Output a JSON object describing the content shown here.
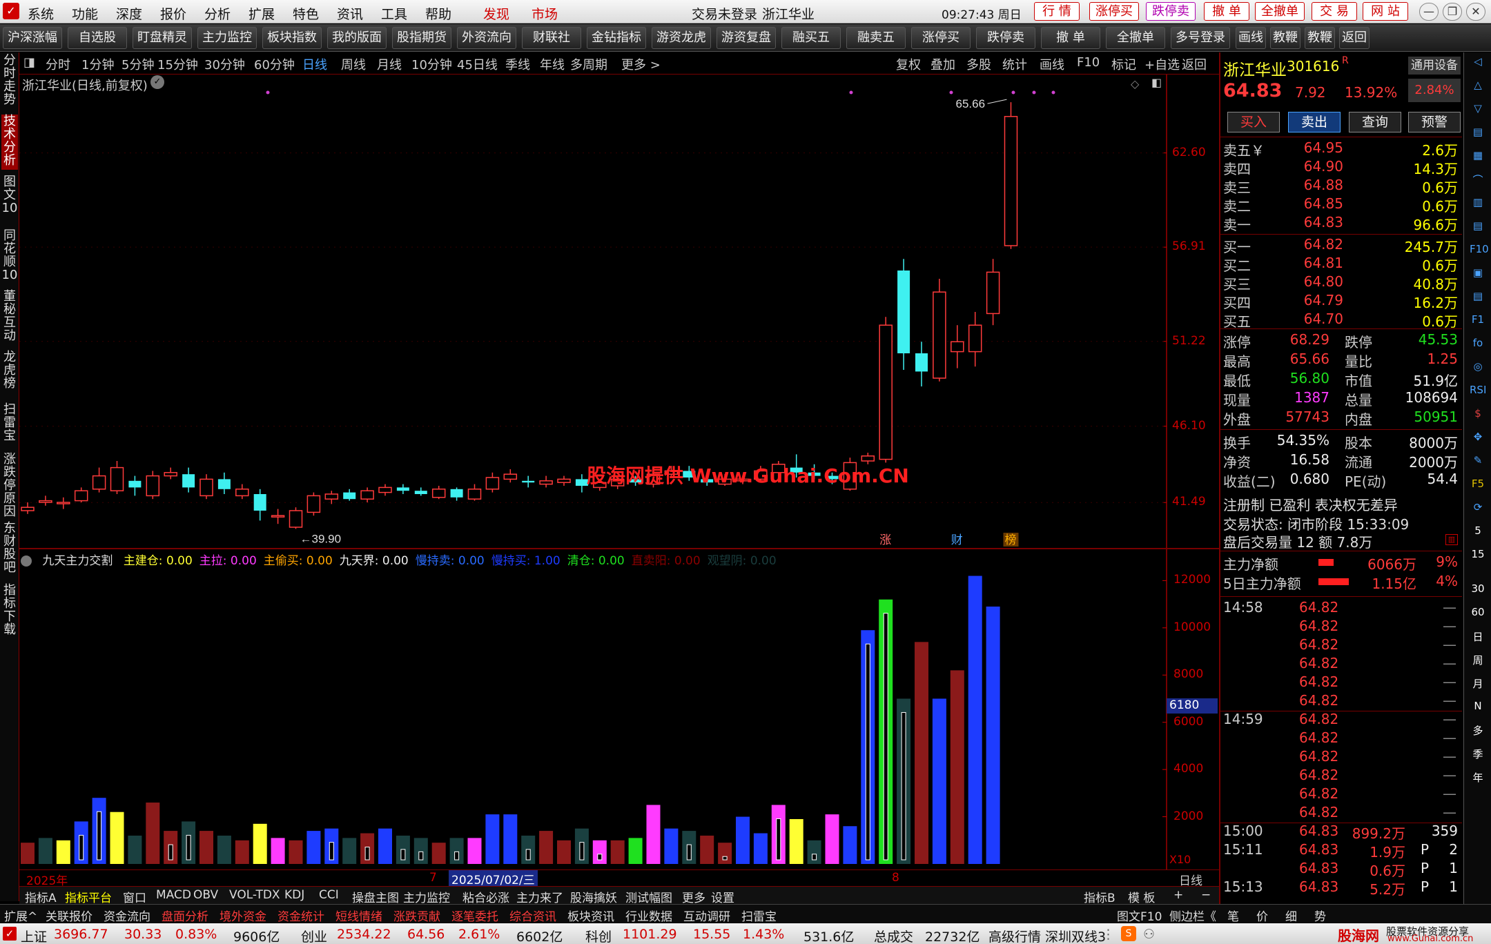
{
  "menubar": {
    "items": [
      "系统",
      "功能",
      "深度",
      "报价",
      "分析",
      "扩展",
      "特色",
      "资讯",
      "工具",
      "帮助"
    ],
    "discover": "发现",
    "market": "市场",
    "login_status": "交易未登录",
    "stock_title": "浙江华业",
    "clock": "09:27:43 周日",
    "top_buttons": [
      "行 情",
      "涨停买",
      "跌停卖",
      "撤 单",
      "全撤单",
      "交 易",
      "网 站"
    ]
  },
  "toolbar": {
    "buttons": [
      "沪深涨幅",
      "自选股",
      "盯盘精灵",
      "主力监控",
      "板块指数",
      "我的版面",
      "股指期货",
      "外资流向",
      "财联社",
      "金钻指标",
      "游资龙虎",
      "游资复盘",
      "融买五",
      "融卖五",
      "涨停买",
      "跌停卖",
      "撤 单",
      "全撤单",
      "多号登录",
      "画线",
      "教鞭A",
      "教鞭B",
      "返回"
    ]
  },
  "left_tabs": [
    "分时走势",
    "技术分析",
    "图文10",
    "同花顺10",
    "董秘互动",
    "龙虎榜",
    "扫雷宝",
    "涨跌停原因",
    "东财股吧",
    "指标下载"
  ],
  "periods": {
    "items": [
      "分时",
      "1分钟",
      "5分钟",
      "15分钟",
      "30分钟",
      "60分钟",
      "日线",
      "周线",
      "月线",
      "10分钟",
      "45日线",
      "季线",
      "年线",
      "多周期",
      "更多 >"
    ],
    "active": "日线",
    "right_items": [
      "复权",
      "叠加",
      "多股",
      "统计",
      "画线",
      "F10",
      "标记",
      "+自选",
      "返回"
    ]
  },
  "chart": {
    "title": "浙江华业(日线,前复权)",
    "high_label": "65.66",
    "low_label": "39.90",
    "y_ticks": [
      "62.60",
      "56.91",
      "51.22",
      "46.10",
      "41.49"
    ],
    "event_markers": [
      "涨",
      "财",
      "榜"
    ],
    "watermark": "股海网提供 Www.Guhai.Com.CN"
  },
  "chart_data": {
    "type": "candlestick",
    "title": "浙江华业(日线,前复权)",
    "ylim": [
      39.5,
      66.5
    ],
    "candles": [
      {
        "o": 41.0,
        "c": 41.2,
        "h": 41.5,
        "l": 40.8
      },
      {
        "o": 41.5,
        "c": 41.6,
        "h": 41.9,
        "l": 41.3
      },
      {
        "o": 41.5,
        "c": 41.5,
        "h": 41.8,
        "l": 41.1
      },
      {
        "o": 41.6,
        "c": 42.2,
        "h": 42.4,
        "l": 41.5
      },
      {
        "o": 42.3,
        "c": 43.1,
        "h": 43.6,
        "l": 42.1
      },
      {
        "o": 42.2,
        "c": 43.6,
        "h": 44.0,
        "l": 42.0
      },
      {
        "o": 42.8,
        "c": 42.4,
        "h": 43.1,
        "l": 41.9
      },
      {
        "o": 41.9,
        "c": 43.1,
        "h": 43.4,
        "l": 41.7
      },
      {
        "o": 43.1,
        "c": 43.3,
        "h": 43.6,
        "l": 42.9
      },
      {
        "o": 43.2,
        "c": 42.4,
        "h": 43.6,
        "l": 42.1
      },
      {
        "o": 41.9,
        "c": 42.9,
        "h": 43.2,
        "l": 41.7
      },
      {
        "o": 42.9,
        "c": 42.3,
        "h": 43.3,
        "l": 42.0
      },
      {
        "o": 41.9,
        "c": 42.3,
        "h": 42.6,
        "l": 41.7
      },
      {
        "o": 42.0,
        "c": 41.0,
        "h": 42.3,
        "l": 40.4
      },
      {
        "o": 40.7,
        "c": 40.7,
        "h": 41.1,
        "l": 40.2
      },
      {
        "o": 40.0,
        "c": 41.0,
        "h": 41.2,
        "l": 39.9
      },
      {
        "o": 40.9,
        "c": 41.9,
        "h": 42.1,
        "l": 40.7
      },
      {
        "o": 41.7,
        "c": 42.0,
        "h": 42.2,
        "l": 41.4
      },
      {
        "o": 42.1,
        "c": 41.7,
        "h": 42.3,
        "l": 41.6
      },
      {
        "o": 41.7,
        "c": 42.2,
        "h": 42.4,
        "l": 41.5
      },
      {
        "o": 42.1,
        "c": 42.4,
        "h": 42.6,
        "l": 41.9
      },
      {
        "o": 42.4,
        "c": 42.2,
        "h": 42.6,
        "l": 42.0
      },
      {
        "o": 42.2,
        "c": 42.0,
        "h": 42.4,
        "l": 41.9
      },
      {
        "o": 41.8,
        "c": 42.3,
        "h": 42.5,
        "l": 41.7
      },
      {
        "o": 42.3,
        "c": 41.8,
        "h": 42.4,
        "l": 41.6
      },
      {
        "o": 41.7,
        "c": 42.3,
        "h": 42.6,
        "l": 41.6
      },
      {
        "o": 42.3,
        "c": 43.0,
        "h": 43.3,
        "l": 42.1
      },
      {
        "o": 42.9,
        "c": 43.2,
        "h": 43.5,
        "l": 42.7
      },
      {
        "o": 42.8,
        "c": 42.7,
        "h": 43.1,
        "l": 42.4
      },
      {
        "o": 42.6,
        "c": 42.8,
        "h": 43.1,
        "l": 42.4
      },
      {
        "o": 42.7,
        "c": 42.9,
        "h": 43.1,
        "l": 42.5
      },
      {
        "o": 42.9,
        "c": 42.5,
        "h": 43.2,
        "l": 42.1
      },
      {
        "o": 42.4,
        "c": 42.7,
        "h": 42.9,
        "l": 42.2
      },
      {
        "o": 42.5,
        "c": 42.9,
        "h": 43.1,
        "l": 42.3
      },
      {
        "o": 42.9,
        "c": 42.7,
        "h": 43.1,
        "l": 42.5
      },
      {
        "o": 42.6,
        "c": 43.2,
        "h": 43.5,
        "l": 42.4
      },
      {
        "o": 43.2,
        "c": 43.4,
        "h": 43.7,
        "l": 43.0
      },
      {
        "o": 43.4,
        "c": 43.0,
        "h": 43.7,
        "l": 42.8
      },
      {
        "o": 42.9,
        "c": 42.7,
        "h": 43.1,
        "l": 42.5
      },
      {
        "o": 42.6,
        "c": 42.9,
        "h": 43.2,
        "l": 42.5
      },
      {
        "o": 42.8,
        "c": 42.9,
        "h": 43.1,
        "l": 42.6
      },
      {
        "o": 42.9,
        "c": 43.4,
        "h": 43.7,
        "l": 42.8
      },
      {
        "o": 43.3,
        "c": 43.8,
        "h": 44.0,
        "l": 43.1
      },
      {
        "o": 43.6,
        "c": 43.3,
        "h": 44.4,
        "l": 43.0
      },
      {
        "o": 43.3,
        "c": 43.1,
        "h": 43.8,
        "l": 42.9
      },
      {
        "o": 43.1,
        "c": 42.9,
        "h": 43.3,
        "l": 42.6
      },
      {
        "o": 42.3,
        "c": 43.9,
        "h": 44.2,
        "l": 42.2
      },
      {
        "o": 44.0,
        "c": 44.3,
        "h": 44.5,
        "l": 43.8
      },
      {
        "o": 44.1,
        "c": 52.2,
        "h": 52.7,
        "l": 43.9
      },
      {
        "o": 55.5,
        "c": 50.5,
        "h": 56.2,
        "l": 49.5
      },
      {
        "o": 50.5,
        "c": 49.4,
        "h": 51.2,
        "l": 48.5
      },
      {
        "o": 49.0,
        "c": 54.2,
        "h": 55.0,
        "l": 48.8
      },
      {
        "o": 50.6,
        "c": 51.2,
        "h": 52.2,
        "l": 49.6
      },
      {
        "o": 50.6,
        "c": 52.2,
        "h": 53.0,
        "l": 49.7
      },
      {
        "o": 52.9,
        "c": 55.4,
        "h": 56.2,
        "l": 52.2
      },
      {
        "o": 57.0,
        "c": 64.8,
        "h": 65.66,
        "l": 56.8
      }
    ]
  },
  "indicator": {
    "name": "九天主力交割",
    "items": [
      {
        "label": "主建仓:",
        "value": "0.00",
        "color": "#ffff33"
      },
      {
        "label": "主拉:",
        "value": "0.00",
        "color": "#ff3bff"
      },
      {
        "label": "主偷买:",
        "value": "0.00",
        "color": "#ffa500"
      },
      {
        "label": "九天界:",
        "value": "0.00",
        "color": "#eeeeee"
      },
      {
        "label": "慢持卖:",
        "value": "0.00",
        "color": "#2a6bff"
      },
      {
        "label": "慢持买:",
        "value": "1.00",
        "color": "#1e3cff"
      },
      {
        "label": "清仓:",
        "value": "0.00",
        "color": "#1fe01f"
      },
      {
        "label": "直卖阳:",
        "value": "0.00",
        "color": "#8b0000"
      },
      {
        "label": "观望阴:",
        "value": "0.00",
        "color": "#1a3d3d"
      }
    ],
    "y_ticks": [
      "12000",
      "10000",
      "8000",
      "6000",
      "4000",
      "2000"
    ],
    "current_marker": "6180",
    "multiplier": "X10",
    "bars": [
      {
        "v": 900,
        "c": "#8b1a1a"
      },
      {
        "v": 1100,
        "c": "#1a4040"
      },
      {
        "v": 1000,
        "c": "#ffff33"
      },
      {
        "v": 1800,
        "c": "#1e3cff",
        "hollow": true
      },
      {
        "v": 2800,
        "c": "#1e3cff",
        "hollow": true
      },
      {
        "v": 2200,
        "c": "#ffff33"
      },
      {
        "v": 1200,
        "c": "#1a4040"
      },
      {
        "v": 2600,
        "c": "#8b1a1a"
      },
      {
        "v": 1400,
        "c": "#8b1a1a",
        "hollow": true
      },
      {
        "v": 1800,
        "c": "#1a4040",
        "hollow": true
      },
      {
        "v": 1400,
        "c": "#8b1a1a"
      },
      {
        "v": 1200,
        "c": "#1a4040"
      },
      {
        "v": 1000,
        "c": "#8b1a1a"
      },
      {
        "v": 1700,
        "c": "#ffff33"
      },
      {
        "v": 1100,
        "c": "#ff3bff"
      },
      {
        "v": 1000,
        "c": "#8b1a1a"
      },
      {
        "v": 1400,
        "c": "#1e3cff"
      },
      {
        "v": 1500,
        "c": "#1e3cff",
        "hollow": true
      },
      {
        "v": 1100,
        "c": "#1a4040"
      },
      {
        "v": 1300,
        "c": "#8b1a1a",
        "hollow": true
      },
      {
        "v": 1500,
        "c": "#1e3cff"
      },
      {
        "v": 1200,
        "c": "#1a4040",
        "hollow": true
      },
      {
        "v": 1100,
        "c": "#1a4040",
        "hollow": true
      },
      {
        "v": 900,
        "c": "#8b1a1a"
      },
      {
        "v": 1100,
        "c": "#1a4040",
        "hollow": true
      },
      {
        "v": 1100,
        "c": "#ff3bff"
      },
      {
        "v": 2100,
        "c": "#1e3cff"
      },
      {
        "v": 2100,
        "c": "#1e3cff"
      },
      {
        "v": 1200,
        "c": "#1a4040",
        "hollow": true
      },
      {
        "v": 1400,
        "c": "#8b1a1a"
      },
      {
        "v": 1000,
        "c": "#8b1a1a"
      },
      {
        "v": 1500,
        "c": "#1a4040",
        "hollow": true
      },
      {
        "v": 1000,
        "c": "#ff3bff",
        "hollow": true
      },
      {
        "v": 1000,
        "c": "#8b1a1a"
      },
      {
        "v": 1100,
        "c": "#1fe01f"
      },
      {
        "v": 2500,
        "c": "#ff3bff"
      },
      {
        "v": 1500,
        "c": "#1e3cff"
      },
      {
        "v": 1400,
        "c": "#1a4040",
        "hollow": true
      },
      {
        "v": 1200,
        "c": "#8b1a1a"
      },
      {
        "v": 900,
        "c": "#8b1a1a",
        "hollow": true
      },
      {
        "v": 2000,
        "c": "#1e3cff"
      },
      {
        "v": 1300,
        "c": "#1e3cff"
      },
      {
        "v": 2500,
        "c": "#ff3bff",
        "hollow": true
      },
      {
        "v": 1900,
        "c": "#ffff33"
      },
      {
        "v": 1000,
        "c": "#1a4040",
        "hollow": true
      },
      {
        "v": 2100,
        "c": "#ff3bff"
      },
      {
        "v": 1600,
        "c": "#1e3cff"
      },
      {
        "v": 9900,
        "c": "#1e3cff",
        "hollow": true
      },
      {
        "v": 11200,
        "c": "#1fe01f",
        "hollow": true
      },
      {
        "v": 7000,
        "c": "#1a4040",
        "hollow": true
      },
      {
        "v": 9400,
        "c": "#8b1a1a"
      },
      {
        "v": 7000,
        "c": "#1e3cff"
      },
      {
        "v": 8200,
        "c": "#8b1a1a"
      },
      {
        "v": 12200,
        "c": "#1e3cff"
      },
      {
        "v": 10900,
        "c": "#1e3cff"
      }
    ]
  },
  "date_axis": {
    "year_label": "2025年",
    "month_7": "7",
    "cursor_date": "2025/07/02/三",
    "month_8": "8",
    "period": "日线"
  },
  "bottom_tabs": {
    "items": [
      "指标A",
      "指标平台",
      "窗口",
      "MACD",
      "OBV",
      "VOL-TDX",
      "KDJ",
      "CCI",
      "操盘主图",
      "主力监控",
      "粘合必涨",
      "主力来了",
      "股海擒妖",
      "测试幅图",
      "更多",
      "设置"
    ],
    "right": [
      "指标B",
      "模 板",
      "+",
      "−"
    ]
  },
  "func_bar": {
    "items": [
      "扩展^",
      "关联报价",
      "资金流向",
      "盘面分析",
      "境外资金",
      "资金统计",
      "短线情绪",
      "涨跌贡献",
      "逐笔委托",
      "综合资讯",
      "板块资讯",
      "行业数据",
      "互动调研",
      "扫雷宝"
    ],
    "right": [
      "图文F10",
      "侧边栏《",
      "笔",
      "价",
      "细",
      "势"
    ]
  },
  "status_bar": {
    "sh_label": "上证",
    "sh_value": "3696.77",
    "sh_change": "30.33",
    "sh_pct": "0.83%",
    "sh_amount": "9606亿",
    "cy_label": "创业",
    "cy_value": "2534.22",
    "cy_change": "64.56",
    "cy_pct": "2.61%",
    "cy_amount": "6602亿",
    "kc_label": "科创",
    "kc_value": "1101.29",
    "kc_change": "15.55",
    "kc_pct": "1.43%",
    "kc_amount": "531.6亿",
    "total_label": "总成交",
    "total_value": "22732亿",
    "feed": "高级行情 深圳双线3",
    "brand": "股海网",
    "brand_sub": "股票软件资源分享",
    "brand_url": "www.Guhai.com.cn"
  },
  "quote": {
    "name": "浙江华业",
    "code": "301616",
    "code_mark": "R",
    "settings": "通用设备",
    "price": "64.83",
    "change": "7.92",
    "pct": "13.92%",
    "side_pct": "2.84%",
    "actions": [
      "买入",
      "卖出",
      "查询",
      "预警"
    ],
    "asks": [
      {
        "label": "卖五￥",
        "price": "64.95",
        "vol": "2.6万"
      },
      {
        "label": "卖四",
        "price": "64.90",
        "vol": "14.3万"
      },
      {
        "label": "卖三",
        "price": "64.88",
        "vol": "0.6万"
      },
      {
        "label": "卖二",
        "price": "64.85",
        "vol": "0.6万"
      },
      {
        "label": "卖一",
        "price": "64.83",
        "vol": "96.6万"
      }
    ],
    "bids": [
      {
        "label": "买一",
        "price": "64.82",
        "vol": "245.7万"
      },
      {
        "label": "买二",
        "price": "64.81",
        "vol": "0.6万"
      },
      {
        "label": "买三",
        "price": "64.80",
        "vol": "40.8万"
      },
      {
        "label": "买四",
        "price": "64.79",
        "vol": "16.2万"
      },
      {
        "label": "买五",
        "price": "64.70",
        "vol": "0.6万"
      }
    ],
    "stats": [
      {
        "l1": "涨停",
        "v1": "68.29",
        "c1": "red",
        "l2": "跌停",
        "v2": "45.53",
        "c2": "grn"
      },
      {
        "l1": "最高",
        "v1": "65.66",
        "c1": "red",
        "l2": "量比",
        "v2": "1.25",
        "c2": "red"
      },
      {
        "l1": "最低",
        "v1": "56.80",
        "c1": "grn",
        "l2": "市值",
        "v2": "51.9亿",
        "c2": "wht"
      },
      {
        "l1": "现量",
        "v1": "1387",
        "c1": "mag",
        "l2": "总量",
        "v2": "108694",
        "c2": "wht"
      },
      {
        "l1": "外盘",
        "v1": "57743",
        "c1": "red",
        "l2": "内盘",
        "v2": "50951",
        "c2": "grn"
      }
    ],
    "stats2": [
      {
        "l1": "换手",
        "v1": "54.35%",
        "l2": "股本",
        "v2": "8000万"
      },
      {
        "l1": "净资",
        "v1": "16.58",
        "l2": "流通",
        "v2": "2000万"
      },
      {
        "l1": "收益(二)",
        "v1": "0.680",
        "l2": "PE(动)",
        "v2": "54.4"
      }
    ],
    "info1": "注册制 已盈利 表决权无差异",
    "info2": "交易状态: 闭市阶段 15:33:09",
    "info3": "盘后交易量 12 额 7.8万",
    "main_flow_label": "主力净额",
    "main_flow_value": "6066万",
    "main_flow_pct": "9%",
    "main5_label": "5日主力净额",
    "main5_value": "1.15亿",
    "main5_pct": "4%",
    "ticks": [
      {
        "t": "14:58",
        "p": "64.82",
        "v": "",
        "f": "",
        "n": ""
      },
      {
        "t": "",
        "p": "64.82",
        "v": "",
        "f": "",
        "n": ""
      },
      {
        "t": "",
        "p": "64.82",
        "v": "",
        "f": "",
        "n": ""
      },
      {
        "t": "",
        "p": "64.82",
        "v": "",
        "f": "",
        "n": ""
      },
      {
        "t": "",
        "p": "64.82",
        "v": "",
        "f": "",
        "n": ""
      },
      {
        "t": "",
        "p": "64.82",
        "v": "",
        "f": "",
        "n": ""
      },
      {
        "t": "14:59",
        "p": "64.82",
        "v": "",
        "f": "",
        "n": ""
      },
      {
        "t": "",
        "p": "64.82",
        "v": "",
        "f": "",
        "n": ""
      },
      {
        "t": "",
        "p": "64.82",
        "v": "",
        "f": "",
        "n": ""
      },
      {
        "t": "",
        "p": "64.82",
        "v": "",
        "f": "",
        "n": ""
      },
      {
        "t": "",
        "p": "64.82",
        "v": "",
        "f": "",
        "n": ""
      },
      {
        "t": "",
        "p": "64.82",
        "v": "",
        "f": "",
        "n": ""
      },
      {
        "t": "15:00",
        "p": "64.83",
        "v": "899.2万",
        "f": "",
        "n": "359"
      },
      {
        "t": "15:11",
        "p": "64.83",
        "v": "1.9万",
        "f": "P",
        "n": "2"
      },
      {
        "t": "",
        "p": "64.83",
        "v": "0.6万",
        "f": "P",
        "n": "1"
      },
      {
        "t": "15:13",
        "p": "64.83",
        "v": "5.2万",
        "f": "P",
        "n": "1"
      }
    ]
  },
  "right_strip": [
    "◁",
    "△",
    "▽",
    "▤",
    "▦",
    "⌒",
    "▥",
    "▤",
    "F10",
    "▣",
    "▤",
    "F1",
    "fo",
    "◎",
    "RSI",
    "$",
    "✥",
    "✎",
    "F5",
    "⟳",
    "5",
    "15",
    "30",
    "60",
    "日",
    "周",
    "月",
    "N",
    "多",
    "季",
    "年"
  ]
}
